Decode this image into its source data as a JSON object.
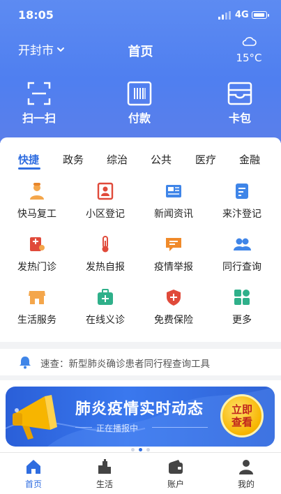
{
  "status": {
    "time": "18:05",
    "network": "4G"
  },
  "header": {
    "city": "开封市",
    "title": "首页",
    "temperature": "15°C",
    "weather_icon": "cloud-icon"
  },
  "quick_actions": [
    {
      "label": "扫一扫",
      "icon": "scan-icon"
    },
    {
      "label": "付款",
      "icon": "barcode-icon"
    },
    {
      "label": "卡包",
      "icon": "wallet-icon"
    }
  ],
  "tabs": [
    "快捷",
    "政务",
    "综治",
    "公共",
    "医疗",
    "金融"
  ],
  "active_tab": "快捷",
  "services": [
    {
      "label": "快马复工",
      "icon": "worker-icon"
    },
    {
      "label": "小区登记",
      "icon": "id-card-icon"
    },
    {
      "label": "新闻资讯",
      "icon": "newspaper-icon"
    },
    {
      "label": "来汴登记",
      "icon": "form-icon"
    },
    {
      "label": "发热门诊",
      "icon": "clinic-icon"
    },
    {
      "label": "发热自报",
      "icon": "thermometer-icon"
    },
    {
      "label": "疫情举报",
      "icon": "message-icon"
    },
    {
      "label": "同行查询",
      "icon": "people-icon"
    },
    {
      "label": "生活服务",
      "icon": "shop-icon"
    },
    {
      "label": "在线义诊",
      "icon": "medkit-icon"
    },
    {
      "label": "免费保险",
      "icon": "shield-icon"
    },
    {
      "label": "更多",
      "icon": "grid-icon"
    }
  ],
  "notice": {
    "text": "速查：新型肺炎确诊患者同行程查询工具"
  },
  "banner": {
    "title": "肺炎疫情实时动态",
    "subtitle": "正在播报中",
    "cta_line1": "立即",
    "cta_line2": "查看"
  },
  "tabbar": [
    {
      "label": "首页",
      "icon": "home-icon",
      "active": true
    },
    {
      "label": "生活",
      "icon": "city-icon",
      "active": false
    },
    {
      "label": "账户",
      "icon": "wallet-icon",
      "active": false
    },
    {
      "label": "我的",
      "icon": "user-icon",
      "active": false
    }
  ],
  "colors": {
    "accent": "#2f6de0",
    "header": "#5686f0"
  }
}
